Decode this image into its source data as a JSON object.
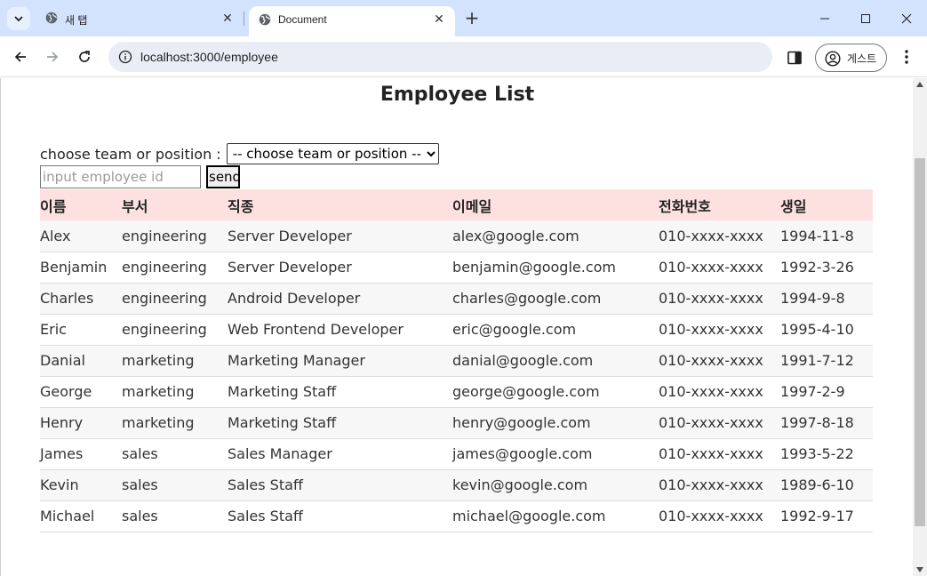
{
  "browser": {
    "tabs": [
      {
        "title": "새 탭",
        "active": false
      },
      {
        "title": "Document",
        "active": true
      }
    ],
    "url": "localhost:3000/employee",
    "profile_label": "게스트"
  },
  "page": {
    "title": "Employee List",
    "filter": {
      "label": "choose team or position :",
      "selected": "-- choose team or position --"
    },
    "search": {
      "placeholder": "input employee id",
      "value": "",
      "button_label": "send"
    },
    "table": {
      "header_color": "#fde0e0",
      "columns": [
        "이름",
        "부서",
        "직종",
        "이메일",
        "전화번호",
        "생일"
      ],
      "rows": [
        [
          "Alex",
          "engineering",
          "Server Developer",
          "alex@google.com",
          "010-xxxx-xxxx",
          "1994-11-8"
        ],
        [
          "Benjamin",
          "engineering",
          "Server Developer",
          "benjamin@google.com",
          "010-xxxx-xxxx",
          "1992-3-26"
        ],
        [
          "Charles",
          "engineering",
          "Android Developer",
          "charles@google.com",
          "010-xxxx-xxxx",
          "1994-9-8"
        ],
        [
          "Eric",
          "engineering",
          "Web Frontend Developer",
          "eric@google.com",
          "010-xxxx-xxxx",
          "1995-4-10"
        ],
        [
          "Danial",
          "marketing",
          "Marketing Manager",
          "danial@google.com",
          "010-xxxx-xxxx",
          "1991-7-12"
        ],
        [
          "George",
          "marketing",
          "Marketing Staff",
          "george@google.com",
          "010-xxxx-xxxx",
          "1997-2-9"
        ],
        [
          "Henry",
          "marketing",
          "Marketing Staff",
          "henry@google.com",
          "010-xxxx-xxxx",
          "1997-8-18"
        ],
        [
          "James",
          "sales",
          "Sales Manager",
          "james@google.com",
          "010-xxxx-xxxx",
          "1993-5-22"
        ],
        [
          "Kevin",
          "sales",
          "Sales Staff",
          "kevin@google.com",
          "010-xxxx-xxxx",
          "1989-6-10"
        ],
        [
          "Michael",
          "sales",
          "Sales Staff",
          "michael@google.com",
          "010-xxxx-xxxx",
          "1992-9-17"
        ]
      ]
    }
  }
}
